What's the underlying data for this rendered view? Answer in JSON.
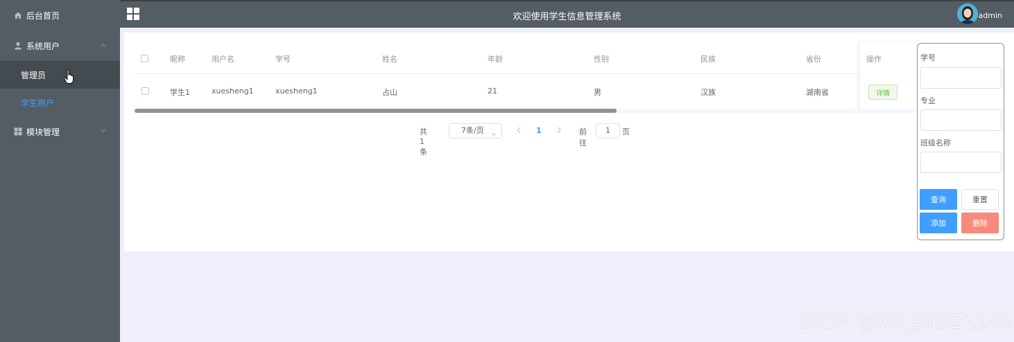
{
  "sidebar": {
    "home": "后台首页",
    "system_users": "系统用户",
    "admin": "管理员",
    "student_users": "学生用户",
    "module_mgmt": "模块管理"
  },
  "topbar": {
    "title": "欢迎使用学生信息管理系统",
    "username": "admin"
  },
  "table": {
    "headers": [
      "昵称",
      "用户名",
      "学号",
      "姓名",
      "年龄",
      "性别",
      "民族",
      "省份"
    ],
    "op_header": "操作",
    "rows": [
      [
        "学生1",
        "xuesheng1",
        "xuesheng1",
        "占山",
        "21",
        "男",
        "汉族",
        "湖南省"
      ]
    ],
    "detail_label": "详情"
  },
  "pagination": {
    "total": "共 1 条",
    "page_size": "7条/页",
    "current": "1",
    "goto": "前往",
    "jump_value": "1",
    "page_unit": "页"
  },
  "search_panel": {
    "student_id_label": "学号",
    "major_label": "专业",
    "class_label": "班级名称",
    "query": "查询",
    "reset": "重置",
    "add": "添加",
    "delete": "删除"
  },
  "watermark": "CSDN @VX_BYDZ1988",
  "colors": {
    "sidebar_bg": "#545c64",
    "accent": "#409eff",
    "danger": "#f78a7c",
    "success": "#67c23a"
  }
}
